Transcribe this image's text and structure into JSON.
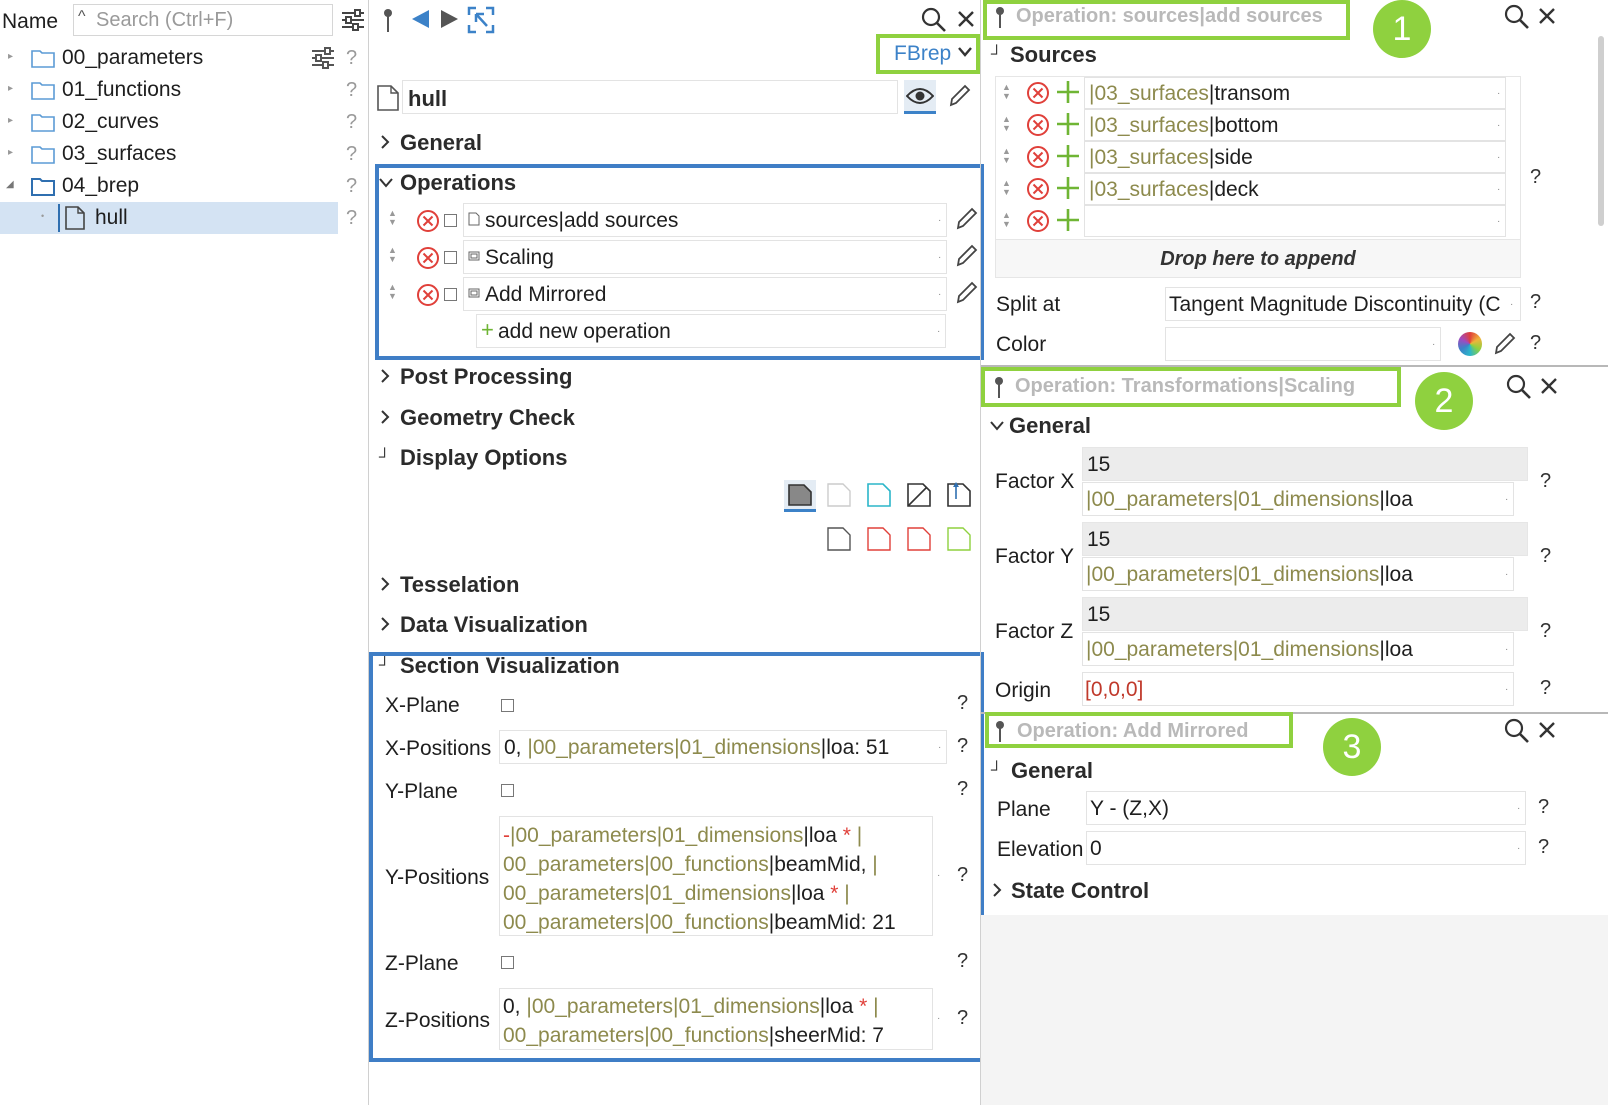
{
  "tree": {
    "name_header": "Name",
    "search_placeholder": "Search (Ctrl+F)",
    "items": [
      {
        "label": "00_parameters"
      },
      {
        "label": "01_functions"
      },
      {
        "label": "02_curves"
      },
      {
        "label": "03_surfaces"
      },
      {
        "label": "04_brep"
      },
      {
        "label": "hull"
      }
    ],
    "help": "?"
  },
  "middle": {
    "type_select": "FBrep",
    "object_name": "hull",
    "sections": {
      "general": "General",
      "operations": "Operations",
      "post_processing": "Post Processing",
      "geometry_check": "Geometry Check",
      "display_options": "Display Options",
      "tesselation": "Tesselation",
      "data_visualization": "Data Visualization",
      "section_visualization": "Section Visualization"
    },
    "operations": [
      {
        "label": "sources|add sources"
      },
      {
        "label": "Scaling"
      },
      {
        "label": "Add Mirrored"
      }
    ],
    "add_operation": "add new operation",
    "section_vis": {
      "x_plane": "X-Plane",
      "x_positions": "X-Positions",
      "y_plane": "Y-Plane",
      "y_positions": "Y-Positions",
      "z_plane": "Z-Plane",
      "z_positions": "Z-Positions",
      "x_pos_prefix": "0, ",
      "x_pos_path1": "|00_parameters",
      "x_pos_path2": "|01_dimensions",
      "x_pos_tail": "|loa: 51",
      "y_pos_line1_a": "-",
      "y_pos_line1_b": "|00_parameters|01_dimensions",
      "y_pos_line1_c": "|loa",
      "y_pos_line1_star": " * ",
      "y_pos_line1_d": "|",
      "y_pos_line2_a": "00_parameters|00_functions",
      "y_pos_line2_b": "|beamMid,",
      "y_pos_line2_c": " |",
      "y_pos_line3_a": "00_parameters|01_dimensions",
      "y_pos_line3_b": "|loa",
      "y_pos_line3_star": " * ",
      "y_pos_line3_c": "|",
      "y_pos_line4_a": "00_parameters|00_functions",
      "y_pos_line4_b": "|beamMid: 21",
      "z_pos_line1_a": "0, ",
      "z_pos_line1_b": "|00_parameters|01_dimensions",
      "z_pos_line1_c": "|loa",
      "z_pos_line1_star": " * ",
      "z_pos_line1_d": "|",
      "z_pos_line2_a": "00_parameters|00_functions",
      "z_pos_line2_b": "|sheerMid: 7"
    }
  },
  "panel1": {
    "title": "Operation: sources|add sources",
    "badge": "1",
    "section": "Sources",
    "sources": [
      {
        "path": "|03_surfaces",
        "name": "|transom"
      },
      {
        "path": "|03_surfaces",
        "name": "|bottom"
      },
      {
        "path": "|03_surfaces",
        "name": "|side"
      },
      {
        "path": "|03_surfaces",
        "name": "|deck"
      }
    ],
    "drop_hint": "Drop here to append",
    "split_label": "Split at",
    "split_value": "Tangent Magnitude Discontinuity (C",
    "color_label": "Color"
  },
  "panel2": {
    "title": "Operation: Transformations|Scaling",
    "badge": "2",
    "section": "General",
    "factor_x": "Factor X",
    "factor_y": "Factor Y",
    "factor_z": "Factor Z",
    "factor_value": "15",
    "factor_path": "|00_parameters|01_dimensions",
    "factor_tail": "|loa",
    "origin_label": "Origin",
    "origin_value": "[0,0,0]"
  },
  "panel3": {
    "title": "Operation: Add Mirrored",
    "badge": "3",
    "section": "General",
    "plane_label": "Plane",
    "plane_value": "Y - (Z,X)",
    "elevation_label": "Elevation",
    "elevation_value": "0",
    "state_control": "State Control"
  },
  "colors": {
    "highlight_green": "#8fd13f",
    "highlight_blue": "#3f7ec6",
    "path_olive": "#8d8a4d",
    "delete_red": "#e0403a",
    "add_green": "#6fb534",
    "nav_blue": "#3c82c8"
  }
}
